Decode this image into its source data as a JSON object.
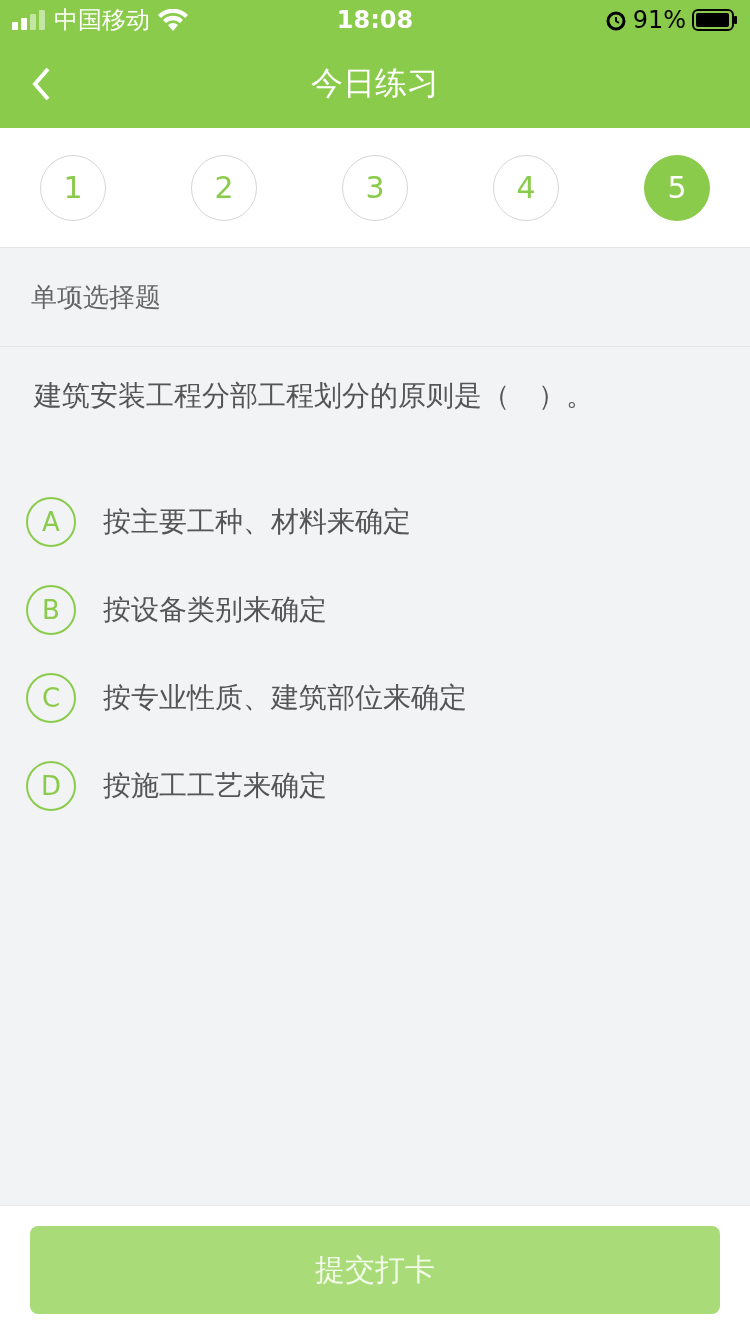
{
  "status_bar": {
    "carrier": "中国移动",
    "time": "18:08",
    "battery": "91%"
  },
  "header": {
    "title": "今日练习"
  },
  "question_tabs": [
    {
      "label": "1",
      "selected": false
    },
    {
      "label": "2",
      "selected": false
    },
    {
      "label": "3",
      "selected": false
    },
    {
      "label": "4",
      "selected": false
    },
    {
      "label": "5",
      "selected": true
    }
  ],
  "section": "单项选择题",
  "question": "建筑安装工程分部工程划分的原则是（　）。",
  "options": [
    {
      "letter": "A",
      "text": "按主要工种、材料来确定",
      "selected": false
    },
    {
      "letter": "B",
      "text": "按设备类别来确定",
      "selected": false
    },
    {
      "letter": "C",
      "text": "按专业性质、建筑部位来确定",
      "selected": false
    },
    {
      "letter": "D",
      "text": "按施工工艺来确定",
      "selected": false
    }
  ],
  "submit": {
    "label": "提交打卡",
    "disabled": true
  }
}
